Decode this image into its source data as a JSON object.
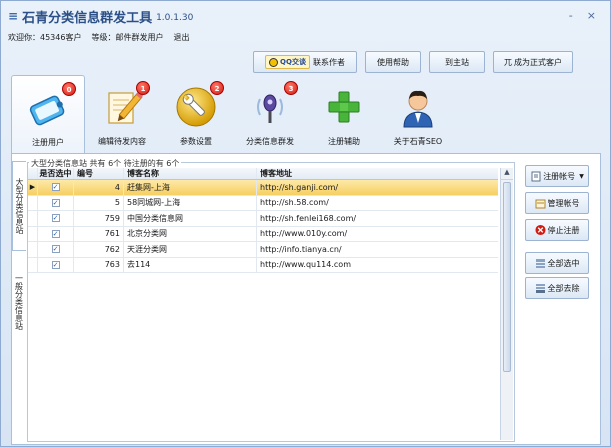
{
  "window": {
    "title": "石青分类信息群发工具",
    "version": "1.0.1.30",
    "minimize": "-",
    "close": "×"
  },
  "userline": {
    "welcome": "欢迎你：45346客户",
    "level": "等级：邮件群发用户",
    "logout": "退出"
  },
  "header_buttons": {
    "qq_pill": "QQ交谈",
    "contact": "联系作者",
    "help": "使用帮助",
    "site": "到主站",
    "upgrade_glyph": "兀",
    "upgrade": "成为正式客户"
  },
  "toolbar": [
    {
      "label": "注册用户",
      "badge": "0",
      "icon": "register-icon"
    },
    {
      "label": "编辑待发内容",
      "badge": "1",
      "icon": "edit-icon"
    },
    {
      "label": "参数设置",
      "badge": "2",
      "icon": "settings-icon"
    },
    {
      "label": "分类信息群发",
      "badge": "3",
      "icon": "broadcast-icon"
    },
    {
      "label": "注册辅助",
      "icon": "add-icon"
    },
    {
      "label": "关于石青SEO",
      "icon": "user-icon"
    }
  ],
  "vtabs": [
    "大型分类信息站",
    "一般分类信息站"
  ],
  "group_caption": "大型分类信息站 共有 6个 待注册的有 6个",
  "grid": {
    "headers": [
      "是否选中",
      "编号",
      "博客名称",
      "博客地址"
    ],
    "rows": [
      {
        "num": "4",
        "name": "赶集网-上海",
        "url": "http://sh.ganji.com/",
        "selected": true
      },
      {
        "num": "5",
        "name": "58同城网-上海",
        "url": "http://sh.58.com/",
        "selected": false
      },
      {
        "num": "759",
        "name": "中国分类信息网",
        "url": "http://sh.fenlei168.com/",
        "selected": false
      },
      {
        "num": "761",
        "name": "北京分类网",
        "url": "http://www.010y.com/",
        "selected": false
      },
      {
        "num": "762",
        "name": "天涯分类网",
        "url": "http://info.tianya.cn/",
        "selected": false
      },
      {
        "num": "763",
        "name": "去114",
        "url": "http://www.qu114.com",
        "selected": false
      }
    ]
  },
  "side_buttons": {
    "register": "注册帐号",
    "manage": "管理帐号",
    "stop": "停止注册",
    "select_all": "全部选中",
    "remove_all": "全部去除"
  },
  "colors": {
    "accent": "#2b4f86",
    "badge": "#d41a10",
    "selected_row": "#f6cf63",
    "stop": "#d41a10"
  }
}
